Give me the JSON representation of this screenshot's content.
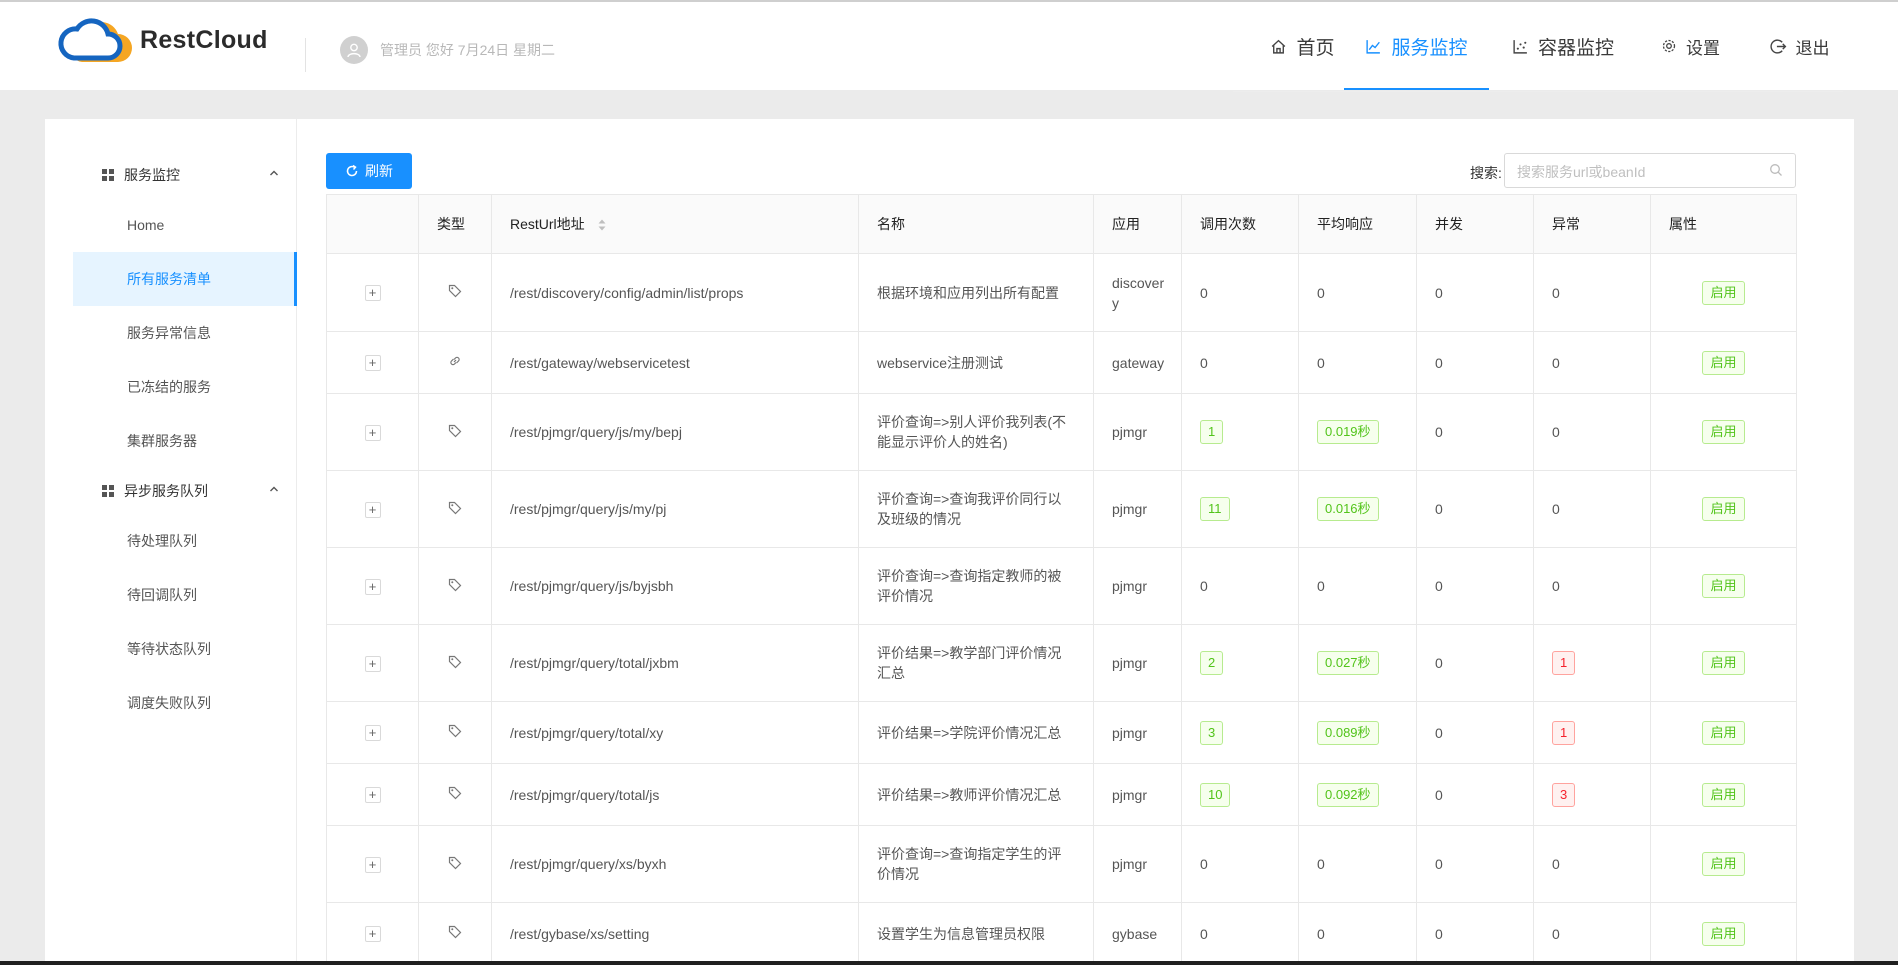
{
  "brand": {
    "name": "RestCloud"
  },
  "user": {
    "greeting": "管理员 您好 7月24日 星期二"
  },
  "nav": [
    {
      "label": "首页",
      "icon": "home-icon",
      "active": false
    },
    {
      "label": "服务监控",
      "icon": "line-chart-icon",
      "active": true
    },
    {
      "label": "容器监控",
      "icon": "dot-chart-icon",
      "active": false
    },
    {
      "label": "设置",
      "icon": "gear-icon",
      "active": false
    },
    {
      "label": "退出",
      "icon": "logout-icon",
      "active": false
    }
  ],
  "sidebar": {
    "groups": [
      {
        "label": "服务监控",
        "items": [
          "Home",
          "所有服务清单",
          "服务异常信息",
          "已冻结的服务",
          "集群服务器"
        ]
      },
      {
        "label": "异步服务队列",
        "items": [
          "待处理队列",
          "待回调队列",
          "等待状态队列",
          "调度失败队列"
        ]
      }
    ],
    "active_item": "所有服务清单"
  },
  "toolbar": {
    "refresh_label": "刷新",
    "search_label": "搜索:",
    "search_placeholder": "搜索服务url或beanId"
  },
  "table": {
    "columns": [
      "",
      "类型",
      "RestUrl地址",
      "名称",
      "应用",
      "调用次数",
      "平均响应",
      "并发",
      "异常",
      "属性"
    ],
    "rows": [
      {
        "type_icon": "tag-icon",
        "url": "/rest/discovery/config/admin/list/props",
        "name": "根据环境和应用列出所有配置",
        "app": "discover\ny",
        "calls": "0",
        "calls_tag": false,
        "avg": "0",
        "avg_tag": false,
        "concurrency": "0",
        "errors": "0",
        "errors_tag": false,
        "status": "启用",
        "height": 78
      },
      {
        "type_icon": "link-icon",
        "url": "/rest/gateway/webservicetest",
        "name": "webservice注册测试",
        "app": "gateway",
        "calls": "0",
        "calls_tag": false,
        "avg": "0",
        "avg_tag": false,
        "concurrency": "0",
        "errors": "0",
        "errors_tag": false,
        "status": "启用",
        "height": 62
      },
      {
        "type_icon": "tag-icon",
        "url": "/rest/pjmgr/query/js/my/bepj",
        "name": "评价查询=>别人评价我列表(不能显示评价人的姓名)",
        "app": "pjmgr",
        "calls": "1",
        "calls_tag": true,
        "avg": "0.019秒",
        "avg_tag": true,
        "concurrency": "0",
        "errors": "0",
        "errors_tag": false,
        "status": "启用",
        "height": 77
      },
      {
        "type_icon": "tag-icon",
        "url": "/rest/pjmgr/query/js/my/pj",
        "name": "评价查询=>查询我评价同行以及班级的情况",
        "app": "pjmgr",
        "calls": "11",
        "calls_tag": true,
        "avg": "0.016秒",
        "avg_tag": true,
        "concurrency": "0",
        "errors": "0",
        "errors_tag": false,
        "status": "启用",
        "height": 77
      },
      {
        "type_icon": "tag-icon",
        "url": "/rest/pjmgr/query/js/byjsbh",
        "name": "评价查询=>查询指定教师的被评价情况",
        "app": "pjmgr",
        "calls": "0",
        "calls_tag": false,
        "avg": "0",
        "avg_tag": false,
        "concurrency": "0",
        "errors": "0",
        "errors_tag": false,
        "status": "启用",
        "height": 77
      },
      {
        "type_icon": "tag-icon",
        "url": "/rest/pjmgr/query/total/jxbm",
        "name": "评价结果=>教学部门评价情况汇总",
        "app": "pjmgr",
        "calls": "2",
        "calls_tag": true,
        "avg": "0.027秒",
        "avg_tag": true,
        "concurrency": "0",
        "errors": "1",
        "errors_tag": true,
        "status": "启用",
        "height": 77
      },
      {
        "type_icon": "tag-icon",
        "url": "/rest/pjmgr/query/total/xy",
        "name": "评价结果=>学院评价情况汇总",
        "app": "pjmgr",
        "calls": "3",
        "calls_tag": true,
        "avg": "0.089秒",
        "avg_tag": true,
        "concurrency": "0",
        "errors": "1",
        "errors_tag": true,
        "status": "启用",
        "height": 62
      },
      {
        "type_icon": "tag-icon",
        "url": "/rest/pjmgr/query/total/js",
        "name": "评价结果=>教师评价情况汇总",
        "app": "pjmgr",
        "calls": "10",
        "calls_tag": true,
        "avg": "0.092秒",
        "avg_tag": true,
        "concurrency": "0",
        "errors": "3",
        "errors_tag": true,
        "status": "启用",
        "height": 62
      },
      {
        "type_icon": "tag-icon",
        "url": "/rest/pjmgr/query/xs/byxh",
        "name": "评价查询=>查询指定学生的评价情况",
        "app": "pjmgr",
        "calls": "0",
        "calls_tag": false,
        "avg": "0",
        "avg_tag": false,
        "concurrency": "0",
        "errors": "0",
        "errors_tag": false,
        "status": "启用",
        "height": 77
      },
      {
        "type_icon": "tag-icon",
        "url": "/rest/gybase/xs/setting",
        "name": "设置学生为信息管理员权限",
        "app": "gybase",
        "calls": "0",
        "calls_tag": false,
        "avg": "0",
        "avg_tag": false,
        "concurrency": "0",
        "errors": "0",
        "errors_tag": false,
        "status": "启用",
        "height": 62
      }
    ]
  },
  "colors": {
    "accent": "#1890ff",
    "success": "#52c41a",
    "danger": "#f5222d",
    "logo_blue": "#1565c0",
    "logo_orange": "#f5a623"
  }
}
